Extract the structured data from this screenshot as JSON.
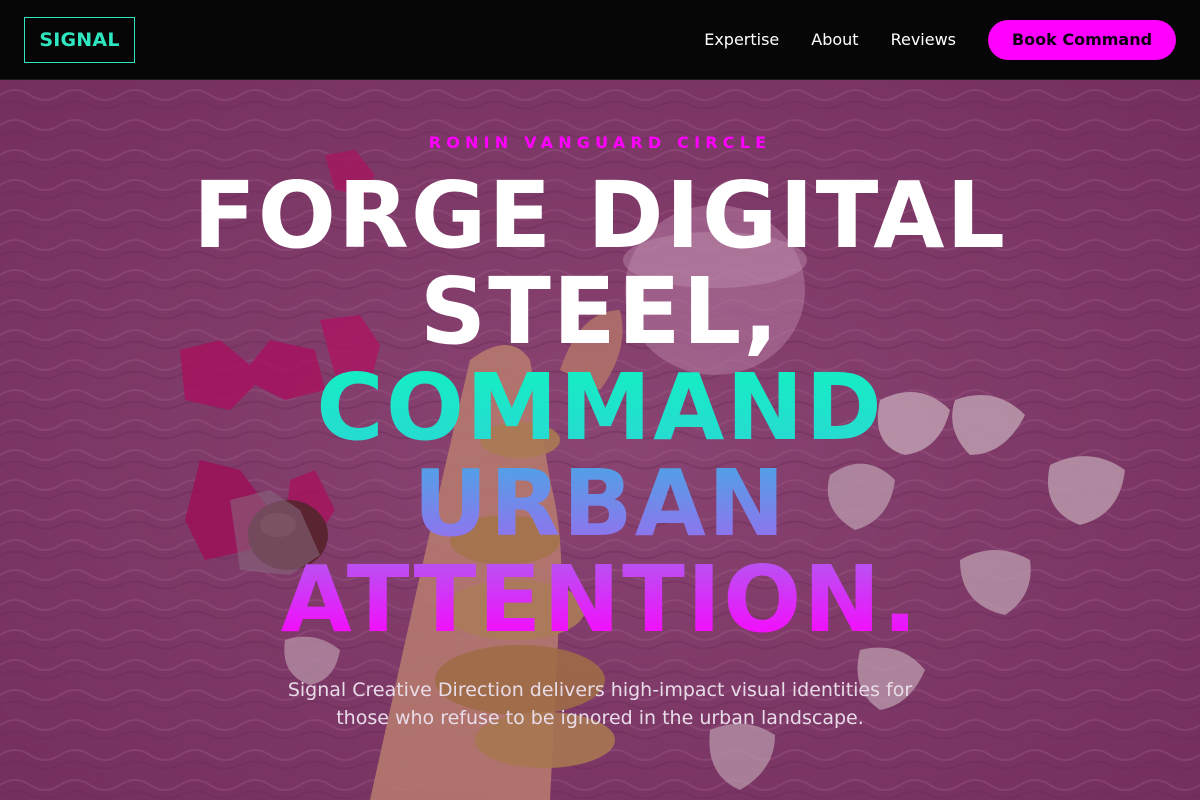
{
  "header": {
    "logo": "SIGNAL",
    "nav": [
      "Expertise",
      "About",
      "Reviews"
    ],
    "cta": "Book Command"
  },
  "hero": {
    "eyebrow": "RONIN VANGUARD CIRCLE",
    "headline_line1": "FORGE DIGITAL",
    "headline_line2": "STEEL,",
    "headline_line3": "COMMAND",
    "headline_line4": "URBAN",
    "headline_line5": "ATTENTION.",
    "subtext": "Signal Creative Direction delivers high-impact visual identities for those who refuse to be ignored in the urban landscape."
  },
  "colors": {
    "accent_magenta": "#ff00ff",
    "accent_teal": "#2ee6c0",
    "header_bg": "#060606"
  }
}
